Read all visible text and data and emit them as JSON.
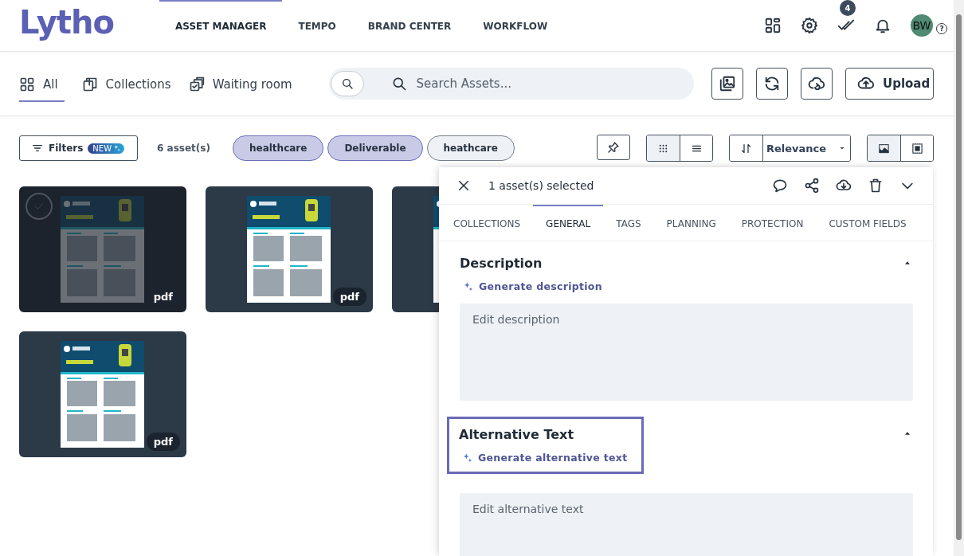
{
  "logo": "Lytho",
  "nav": [
    {
      "label": "ASSET MANAGER",
      "selected": true
    },
    {
      "label": "TEMPO",
      "selected": false
    },
    {
      "label": "BRAND CENTER",
      "selected": false
    },
    {
      "label": "WORKFLOW",
      "selected": false
    }
  ],
  "header": {
    "tasks_badge": "4",
    "avatar": "BW",
    "help": "?"
  },
  "view_tabs": [
    {
      "kind": "all",
      "label": "All",
      "selected": true
    },
    {
      "kind": "collections",
      "label": "Collections",
      "selected": false
    },
    {
      "kind": "waiting",
      "label": "Waiting room",
      "selected": false
    }
  ],
  "search": {
    "placeholder": "Search Assets..."
  },
  "upload_button": "Upload",
  "filters": {
    "label": "Filters",
    "badge": "NEW"
  },
  "asset_count": "6 asset(s)",
  "tags": [
    {
      "label": "healthcare",
      "selected": true
    },
    {
      "label": "Deliverable",
      "selected": true
    },
    {
      "label": "heathcare",
      "selected": false
    }
  ],
  "layout_toggle": [
    {
      "kind": "grid",
      "selected": true
    },
    {
      "kind": "list",
      "selected": false
    }
  ],
  "sort": {
    "label": "Relevance"
  },
  "thumb_toggle": [
    {
      "kind": "fill",
      "selected": true
    },
    {
      "kind": "fit",
      "selected": false
    }
  ],
  "assets": [
    {
      "kind": "picture",
      "type_badge": "pdf",
      "selected": true
    },
    {
      "kind": "picture",
      "type_badge": "pdf",
      "selected": false
    },
    {
      "kind": "picture",
      "selected": false
    },
    {
      "kind": "picture",
      "type_badge": "pdf",
      "selected": false
    }
  ],
  "panel": {
    "title": "1 asset(s) selected",
    "tabs": [
      {
        "label": "COLLECTIONS",
        "selected": false
      },
      {
        "label": "GENERAL",
        "selected": true
      },
      {
        "label": "TAGS",
        "selected": false
      },
      {
        "label": "PLANNING",
        "selected": false
      },
      {
        "label": "PROTECTION",
        "selected": false
      },
      {
        "label": "CUSTOM FIELDS",
        "selected": false
      }
    ],
    "sections": [
      {
        "title": "Description",
        "action": "Generate description",
        "placeholder": "Edit description",
        "expanded": true,
        "highlighted": false
      },
      {
        "title": "Alternative Text",
        "action": "Generate alternative text",
        "placeholder": "Edit alternative text",
        "expanded": true,
        "highlighted": true
      }
    ]
  }
}
